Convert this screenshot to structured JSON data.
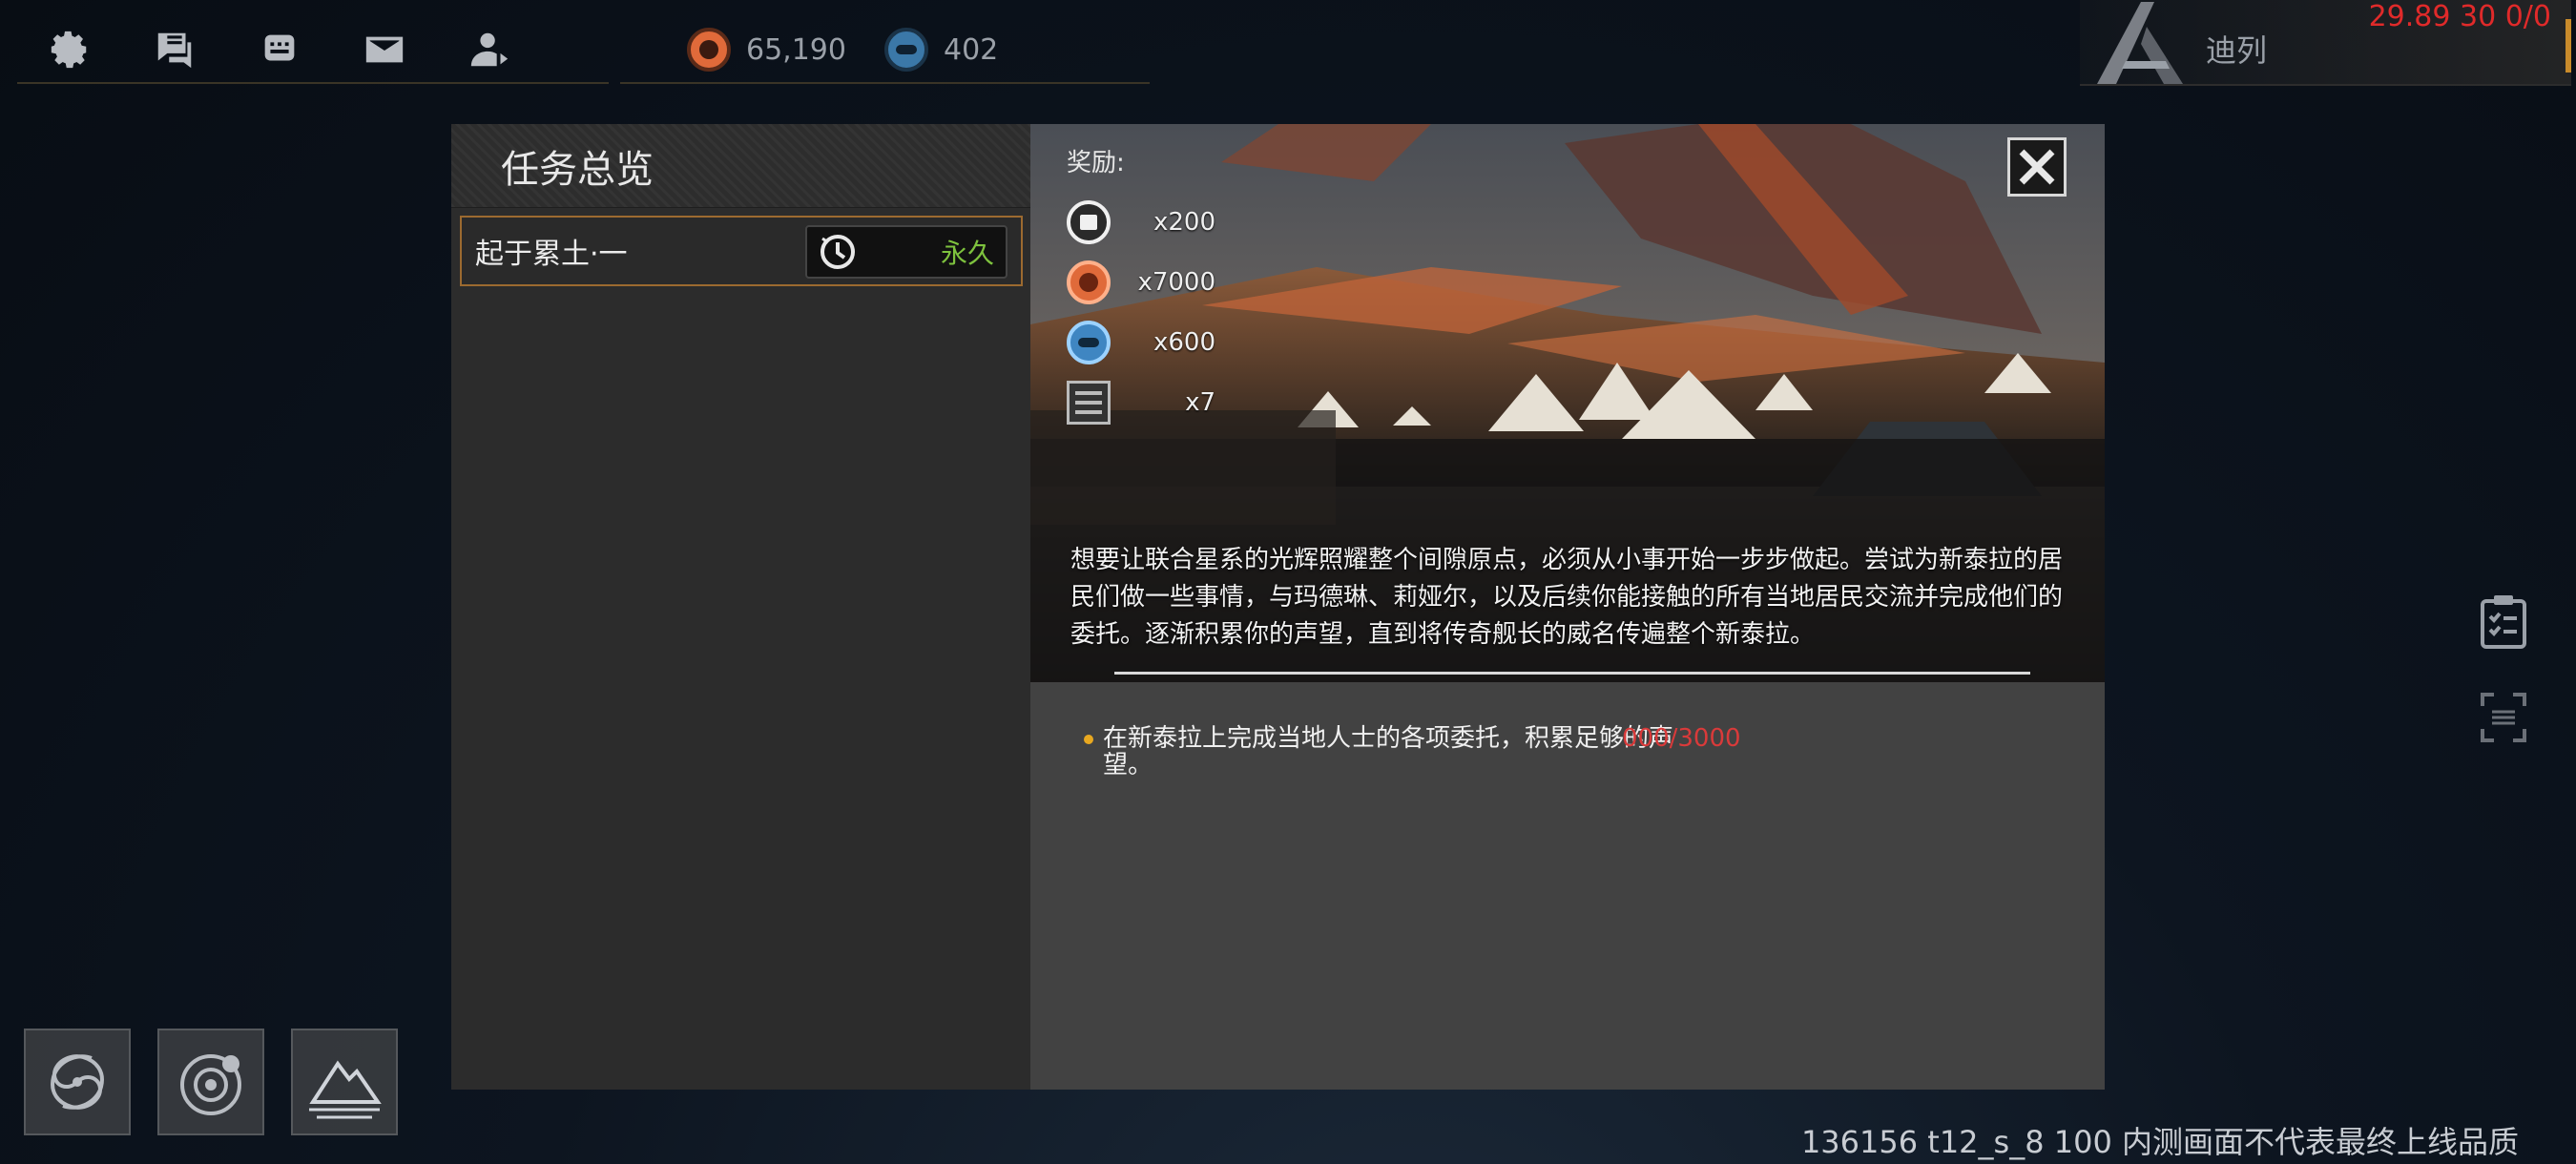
{
  "topbar": {
    "icons": [
      "gear-icon",
      "chat-icon",
      "friends-icon",
      "mail-icon",
      "contact-icon"
    ],
    "resources": [
      {
        "name": "red-resource",
        "icon": "red-resource-icon",
        "value": "65,190",
        "color": "#e06a3a"
      },
      {
        "name": "blue-resource",
        "icon": "blue-resource-icon",
        "value": "402",
        "color": "#3b78a8"
      }
    ]
  },
  "player": {
    "name": "迪列"
  },
  "debug": {
    "fps": "29.89 30 0/0",
    "watermark": "136156 t12_s_8 100  内测画面不代表最终上线品质"
  },
  "dialog": {
    "title": "任务总览",
    "mission": {
      "name": "起于累土·一",
      "duration": "永久",
      "duration_color": "#7ec23e"
    },
    "rewards_title": "奖励:",
    "rewards": [
      {
        "icon": "badge-icon",
        "qty": "x200"
      },
      {
        "icon": "red-resource-icon",
        "qty": "x7000"
      },
      {
        "icon": "blue-resource-icon",
        "qty": "x600"
      },
      {
        "icon": "crate-icon",
        "qty": "x7"
      }
    ],
    "description": "想要让联合星系的光辉照耀整个间隙原点，必须从小事开始一步步做起。尝试为新泰拉的居民们做一些事情，与玛德琳、莉娅尔，以及后续你能接触的所有当地居民交流并完成他们的委托。逐渐积累你的声望，直到将传奇舰长的威名传遍整个新泰拉。",
    "objective": {
      "text": "在新泰拉上完成当地人士的各项委托，积累足够的声望。",
      "progress": "000/3000",
      "progress_color": "#d93a3a"
    }
  }
}
